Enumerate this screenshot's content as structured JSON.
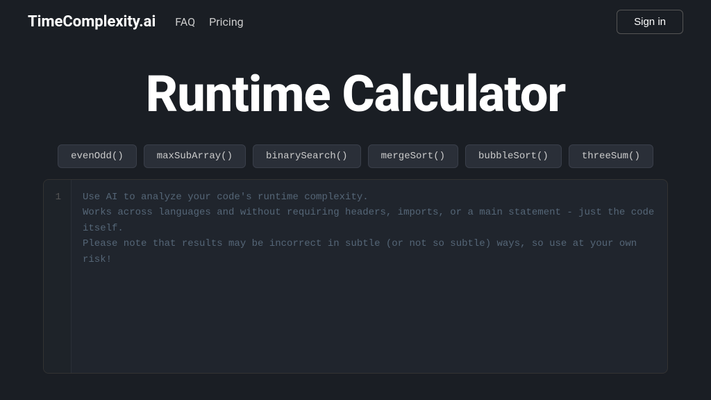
{
  "header": {
    "logo": "TimeComplexity.ai",
    "nav": {
      "faq_label": "FAQ",
      "pricing_label": "Pricing"
    },
    "sign_in_label": "Sign in"
  },
  "main": {
    "title": "Runtime Calculator",
    "examples": [
      {
        "label": "evenOdd()"
      },
      {
        "label": "maxSubArray()"
      },
      {
        "label": "binarySearch()"
      },
      {
        "label": "mergeSort()"
      },
      {
        "label": "bubbleSort()"
      },
      {
        "label": "threeSum()"
      }
    ],
    "editor": {
      "line_number": "1",
      "placeholder_line1": "Use AI to analyze your code's runtime complexity.",
      "placeholder_line2": "Works across languages and without requiring headers, imports, or a main statement - just the code itself.",
      "placeholder_line3": "Please note that results may be incorrect in subtle (or not so subtle) ways, so use at your own risk!"
    }
  }
}
